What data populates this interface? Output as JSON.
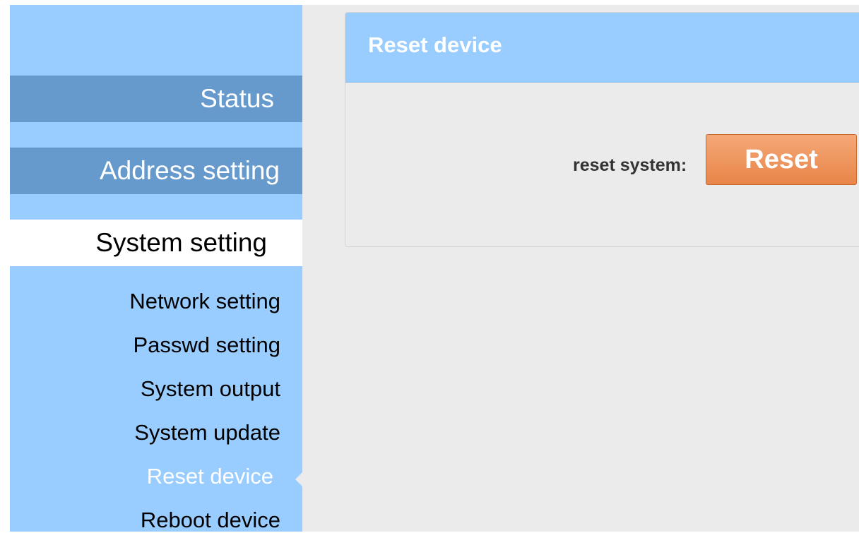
{
  "sidebar": {
    "main_items": [
      {
        "label": "Status"
      },
      {
        "label": "Address setting"
      },
      {
        "label": "System setting"
      }
    ],
    "sub_items": [
      {
        "label": "Network setting"
      },
      {
        "label": "Passwd setting"
      },
      {
        "label": "System output"
      },
      {
        "label": "System update"
      },
      {
        "label": "Reset device"
      },
      {
        "label": "Reboot device"
      }
    ],
    "active_main": "System setting",
    "active_sub": "Reset device"
  },
  "panel": {
    "title": "Reset device",
    "reset_label": "reset system:",
    "reset_button": "Reset"
  },
  "colors": {
    "sidebar_bg": "#99ccff",
    "nav_item_bg": "#6699cc",
    "active_bg": "#ffffff",
    "content_bg": "#ebebeb",
    "button_bg": "#ee9459"
  }
}
